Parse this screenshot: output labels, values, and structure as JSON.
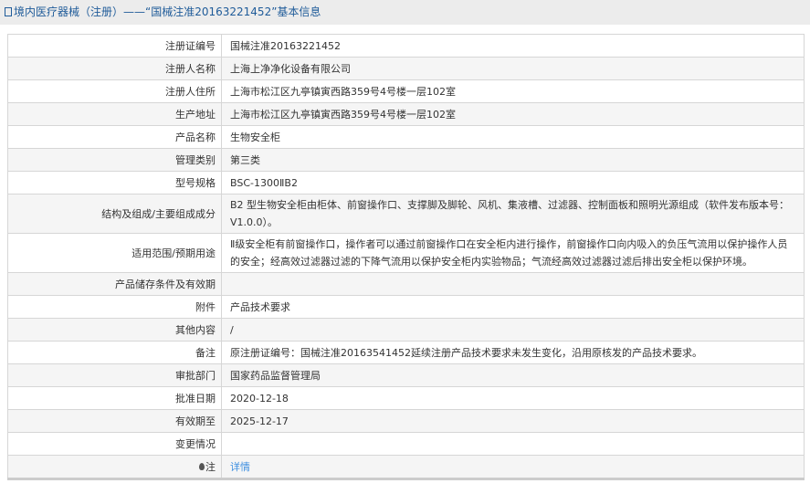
{
  "header": {
    "title": "境内医疗器械（注册）——“国械注准20163221452”基本信息"
  },
  "rows": [
    {
      "label": "注册证编号",
      "value": "国械注准20163221452"
    },
    {
      "label": "注册人名称",
      "value": "上海上净净化设备有限公司"
    },
    {
      "label": "注册人住所",
      "value": "上海市松江区九亭镇寅西路359号4号楼一层102室"
    },
    {
      "label": "生产地址",
      "value": "上海市松江区九亭镇寅西路359号4号楼一层102室"
    },
    {
      "label": "产品名称",
      "value": "生物安全柜"
    },
    {
      "label": "管理类别",
      "value": "第三类"
    },
    {
      "label": "型号规格",
      "value": "BSC-1300ⅡB2"
    },
    {
      "label": "结构及组成/主要组成成分",
      "value": "B2 型生物安全柜由柜体、前窗操作口、支撑脚及脚轮、风机、集液槽、过滤器、控制面板和照明光源组成（软件发布版本号：V1.0.0）。"
    },
    {
      "label": "适用范围/预期用途",
      "value": "Ⅱ级安全柜有前窗操作口，操作者可以通过前窗操作口在安全柜内进行操作，前窗操作口向内吸入的负压气流用以保护操作人员的安全；经高效过滤器过滤的下降气流用以保护安全柜内实验物品；气流经高效过滤器过滤后排出安全柜以保护环境。"
    },
    {
      "label": "产品储存条件及有效期",
      "value": ""
    },
    {
      "label": "附件",
      "value": "产品技术要求"
    },
    {
      "label": "其他内容",
      "value": "/"
    },
    {
      "label": "备注",
      "value": "原注册证编号：国械注准20163541452延续注册产品技术要求未发生变化，沿用原核发的产品技术要求。"
    },
    {
      "label": "审批部门",
      "value": "国家药品监督管理局"
    },
    {
      "label": "批准日期",
      "value": "2020-12-18"
    },
    {
      "label": "有效期至",
      "value": "2025-12-17"
    },
    {
      "label": "变更情况",
      "value": ""
    }
  ],
  "note": {
    "label": "注",
    "link": "详情"
  }
}
